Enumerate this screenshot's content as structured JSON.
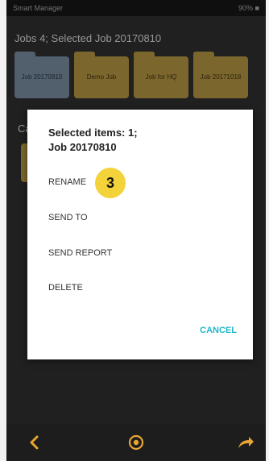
{
  "status_bar": {
    "left_text": "Smart Manager",
    "right_text": "90% ■"
  },
  "header": {
    "title": "Jobs 4; Selected Job 20170810"
  },
  "folders": [
    {
      "label": "Job 20170810",
      "selected": true
    },
    {
      "label": "Demo Job",
      "selected": false
    },
    {
      "label": "Job for HQ",
      "selected": false
    },
    {
      "label": "Job 20171018",
      "selected": false
    }
  ],
  "background": {
    "partial_label": "Ca"
  },
  "dialog": {
    "title_line1": "Selected items: 1;",
    "title_line2": "Job 20170810",
    "items": [
      "RENAME",
      "SEND TO",
      "SEND REPORT",
      "DELETE"
    ],
    "cancel_label": "CANCEL"
  },
  "annotation": {
    "step_number": "3"
  },
  "nav": {
    "back_icon": "chevron-left-icon",
    "home_icon": "circle-target-icon",
    "share_icon": "share-arrow-icon"
  },
  "colors": {
    "accent": "#20b7c9",
    "folder": "#a48a3c",
    "folder_selected": "#6e8193",
    "nav_icon": "#e8a531",
    "annotation_badge": "#f3d23a"
  }
}
